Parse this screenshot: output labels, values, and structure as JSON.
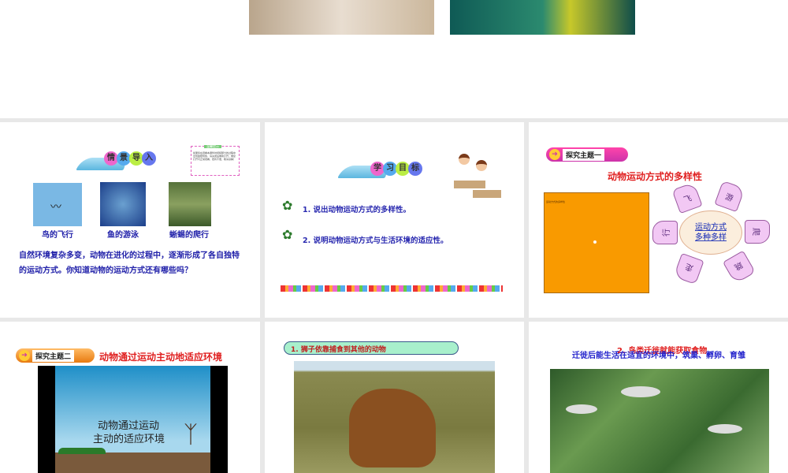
{
  "slide4": {
    "title": "情景导入",
    "tip_title": "温馨提示",
    "tip_text": "如果您在观看本课件时视频部分的过程中出现故障现象，请关闭后重新打开，重复打开可正常观看，若有不便，敬请谅解！",
    "captions": [
      "鸟的飞行",
      "鱼的游泳",
      "蜥蜴的爬行"
    ],
    "body": "自然环境复杂多变，动物在进化的过程中，逐渐形成了各自独特的运动方式。你知道动物的运动方式还有哪些吗？"
  },
  "slide5": {
    "title": "学习目标",
    "goals": [
      "1. 说出动物运动方式的多样性。",
      "2. 说明动物运动方式与生活环境的适应性。"
    ]
  },
  "slide6": {
    "tag": "探究主题一",
    "title": "动物运动方式的多样性",
    "box_label": "运动方式的多样性",
    "center": "运动方式\n多种多样",
    "center_line1": "运动方式",
    "center_line2": "多种多样",
    "petals": [
      "飞",
      "游",
      "爬",
      "跳",
      "走",
      "行"
    ]
  },
  "slide7": {
    "tag": "探究主题二",
    "title": "动物通过运动主动地适应环境",
    "video_line1": "动物通过运动",
    "video_line2": "主动的适应环境"
  },
  "slide8": {
    "heading": "1. 狮子依靠捕食到其他的动物"
  },
  "slide9": {
    "heading_red": "2. 鸟类迁徙就能获取食物",
    "body": "迁徙后能生活在适宜的环境中，筑巢、孵卵、育雏"
  }
}
